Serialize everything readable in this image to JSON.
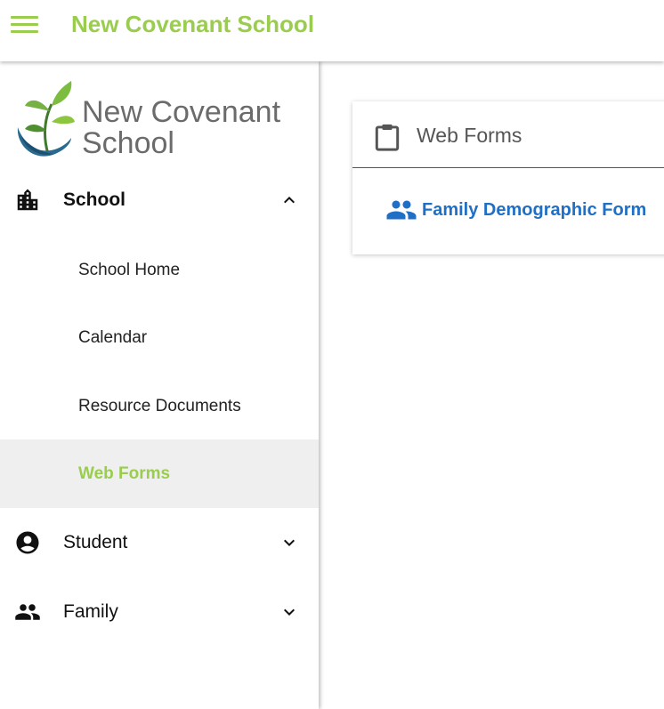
{
  "header": {
    "title": "New Covenant School",
    "menu_icon": "hamburger-menu-icon",
    "accent_color": "#9acd4d"
  },
  "sidebar": {
    "logo": {
      "line1": "New Covenant",
      "line2": "School"
    },
    "sections": [
      {
        "label": "School",
        "icon": "school-building-icon",
        "expanded": true
      },
      {
        "label": "Student",
        "icon": "account-circle-icon",
        "expanded": false
      },
      {
        "label": "Family",
        "icon": "people-icon",
        "expanded": false
      }
    ],
    "school_items": [
      {
        "label": "School Home"
      },
      {
        "label": "Calendar"
      },
      {
        "label": "Resource Documents"
      },
      {
        "label": "Web Forms",
        "active": true
      }
    ]
  },
  "main": {
    "card": {
      "title": "Web Forms",
      "icon": "clipboard-icon",
      "links": [
        {
          "label": "Family Demographic Form",
          "icon": "people-icon",
          "color": "#1f6fc6"
        }
      ]
    }
  }
}
